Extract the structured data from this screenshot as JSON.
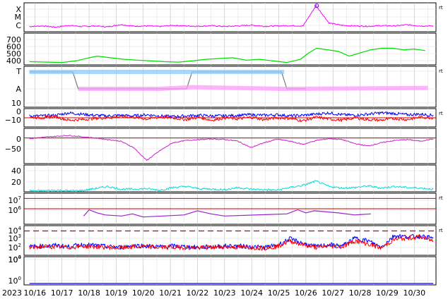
{
  "chart_data": [
    {
      "panel": "xray-class",
      "type": "line",
      "tick_labels": [
        "X",
        "M",
        "C"
      ],
      "flag": "rt",
      "series": [
        {
          "color": "#ff00ff",
          "values": [
            0.18,
            0.2,
            0.16,
            0.22,
            0.18,
            0.2,
            0.17,
            0.25,
            0.19,
            0.2,
            0.18,
            0.22,
            0.2,
            0.19,
            0.21,
            0.18,
            0.2,
            0.23,
            0.19,
            0.2,
            0.21,
            0.2,
            0.9,
            0.3,
            0.22,
            0.2,
            0.19,
            0.21,
            0.2,
            0.24,
            0.2,
            0.2
          ]
        }
      ],
      "marker": {
        "day": 26.4,
        "value": 0.9
      }
    },
    {
      "panel": "speed",
      "type": "line",
      "tick_labels": [
        "700",
        "600",
        "500",
        "400"
      ],
      "ylim": [
        350,
        750
      ],
      "series": [
        {
          "color": "#00dd00",
          "x": [
            15.8,
            16.5,
            17.0,
            17.5,
            18.0,
            18.3,
            18.8,
            19.3,
            19.8,
            20.3,
            20.8,
            21.3,
            21.8,
            22.3,
            22.8,
            23.3,
            23.8,
            24.3,
            24.8,
            25.3,
            25.8,
            26.1,
            26.4,
            26.8,
            27.2,
            27.6,
            28.0,
            28.4,
            28.8,
            29.2,
            29.6,
            30.0,
            30.4
          ],
          "values": [
            390,
            385,
            380,
            400,
            440,
            460,
            440,
            420,
            410,
            400,
            390,
            385,
            400,
            420,
            430,
            440,
            410,
            420,
            400,
            380,
            420,
            500,
            560,
            540,
            520,
            460,
            500,
            540,
            560,
            560,
            540,
            550,
            530
          ]
        }
      ]
    },
    {
      "panel": "polarity",
      "type": "line",
      "tick_labels": [
        "T",
        "A"
      ],
      "flag": "rt",
      "series": [
        {
          "color": "#777777",
          "x": [
            15.8,
            17.4,
            17.6,
            20.3,
            21.6,
            21.8,
            25.1,
            25.3,
            26.0
          ],
          "values": [
            1,
            1,
            0,
            0,
            0,
            1,
            1,
            0,
            0
          ]
        },
        {
          "color": "#ff99ff",
          "x": [
            17.6,
            20.6,
            21.8,
            25.2,
            30.5
          ],
          "values": [
            0,
            0,
            0.1,
            0,
            0.05
          ]
        },
        {
          "color": "#88ccff",
          "x": [
            15.8,
            17.4,
            21.8,
            25.2
          ],
          "values": [
            1,
            1,
            1,
            1
          ]
        }
      ]
    },
    {
      "panel": "bfield",
      "type": "line",
      "tick_labels": [
        "10",
        "0",
        "−10"
      ],
      "ylim": [
        -15,
        15
      ],
      "flag": "rt",
      "series": [
        {
          "color": "#0000ff",
          "values": [
            3,
            3,
            4,
            8,
            6,
            4,
            3,
            4,
            3,
            5,
            3,
            2,
            3,
            4,
            3,
            3,
            4,
            5,
            4,
            5,
            3,
            4,
            6,
            8,
            5,
            4,
            6,
            8,
            7,
            5,
            6,
            4
          ]
        },
        {
          "color": "#ff0000",
          "values": [
            1,
            0,
            2,
            -4,
            -3,
            -1,
            0,
            2,
            1,
            -2,
            1,
            0,
            -3,
            1,
            -4,
            0,
            -2,
            1,
            -3,
            0,
            -1,
            -5,
            1,
            -2,
            -4,
            0,
            -3,
            -4,
            -1,
            -3,
            1,
            0
          ]
        }
      ],
      "reference_line": 0
    },
    {
      "panel": "dst",
      "type": "line",
      "tick_labels": [
        "0",
        "−50"
      ],
      "ylim": [
        -80,
        30
      ],
      "series": [
        {
          "color": "#cc22cc",
          "values": [
            -2,
            2,
            5,
            8,
            4,
            0,
            -5,
            -10,
            -30,
            -70,
            -40,
            -15,
            -8,
            -5,
            -3,
            -5,
            -10,
            -30,
            -15,
            -4,
            -10,
            -20,
            -8,
            -2,
            -5,
            -18,
            -25,
            -15,
            -8,
            -5,
            -10,
            -3
          ]
        }
      ],
      "reference_line": 0
    },
    {
      "panel": "density",
      "type": "line",
      "tick_labels": [
        "40",
        "20"
      ],
      "ylim": [
        0,
        50
      ],
      "series": [
        {
          "color": "#00dddd",
          "values": [
            2,
            2,
            3,
            2,
            2,
            6,
            10,
            5,
            5,
            6,
            3,
            8,
            10,
            6,
            5,
            4,
            8,
            5,
            4,
            3,
            8,
            12,
            20,
            10,
            7,
            8,
            11,
            7,
            10,
            8,
            7,
            5
          ]
        }
      ]
    },
    {
      "panel": "electron-flux",
      "type": "line",
      "tick_labels": [
        "10",
        "10"
      ],
      "tick_exponents": [
        "7",
        "6"
      ],
      "ylim_log": [
        4.5,
        7.5
      ],
      "flag": "rt",
      "series": [
        {
          "color": "#9922cc",
          "x": [
            17.8,
            18.0,
            18.3,
            18.6,
            19.2,
            19.6,
            20.0,
            21.5,
            22.0,
            22.5,
            23.0,
            25.3,
            25.7,
            26.0,
            26.3,
            27.2,
            27.8,
            28.4
          ],
          "values": [
            5.3,
            5.9,
            5.6,
            5.4,
            5.3,
            5.5,
            5.2,
            5.4,
            5.8,
            5.5,
            5.3,
            5.5,
            5.9,
            5.6,
            5.8,
            5.6,
            5.4,
            5.5
          ]
        }
      ],
      "reference_lines": [
        7,
        6
      ]
    },
    {
      "panel": "particles",
      "type": "line",
      "tick_labels": [
        "10",
        "10",
        "10",
        "10"
      ],
      "tick_exponents": [
        "4",
        "3",
        "2",
        "0"
      ],
      "ylim_log": [
        0,
        4.5
      ],
      "flag": "rt",
      "series": [
        {
          "color": "#0000ff",
          "values": [
            1.3,
            1.4,
            1.5,
            1.3,
            1.6,
            1.5,
            1.3,
            1.2,
            1.5,
            1.4,
            1.3,
            1.4,
            1.3,
            1.2,
            1.3,
            1.4,
            1.4,
            1.3,
            1.2,
            1.5,
            2.5,
            1.8,
            1.3,
            1.6,
            1.4,
            2.6,
            2.2,
            1.2,
            3.0,
            2.8,
            2.9,
            2.6
          ]
        },
        {
          "color": "#ff0000",
          "values": [
            1.2,
            1.3,
            1.3,
            1.2,
            1.4,
            1.3,
            1.2,
            1.1,
            1.3,
            1.3,
            1.2,
            1.2,
            1.2,
            1.1,
            1.2,
            1.3,
            1.2,
            1.2,
            1.1,
            1.3,
            2.2,
            1.6,
            1.2,
            1.4,
            1.3,
            2.2,
            1.7,
            1.1,
            2.4,
            2.6,
            2.8,
            2.2
          ]
        }
      ],
      "threshold": 3.7
    },
    {
      "panel": "protons",
      "type": "line",
      "tick_labels": [
        "10",
        "10"
      ],
      "tick_exponents": [
        "4",
        "0"
      ],
      "series": [
        {
          "color": "#0000ff",
          "values": [
            0.05,
            0.05,
            0.05,
            0.05,
            0.05,
            0.05,
            0.05,
            0.05
          ]
        }
      ]
    }
  ],
  "x_axis": {
    "year": "2023",
    "dates": [
      "10/16",
      "10/17",
      "10/18",
      "10/19",
      "10/20",
      "10/21",
      "10/22",
      "10/23",
      "10/24",
      "10/25",
      "10/26",
      "10/27",
      "10/28",
      "10/29",
      "10/30"
    ]
  }
}
